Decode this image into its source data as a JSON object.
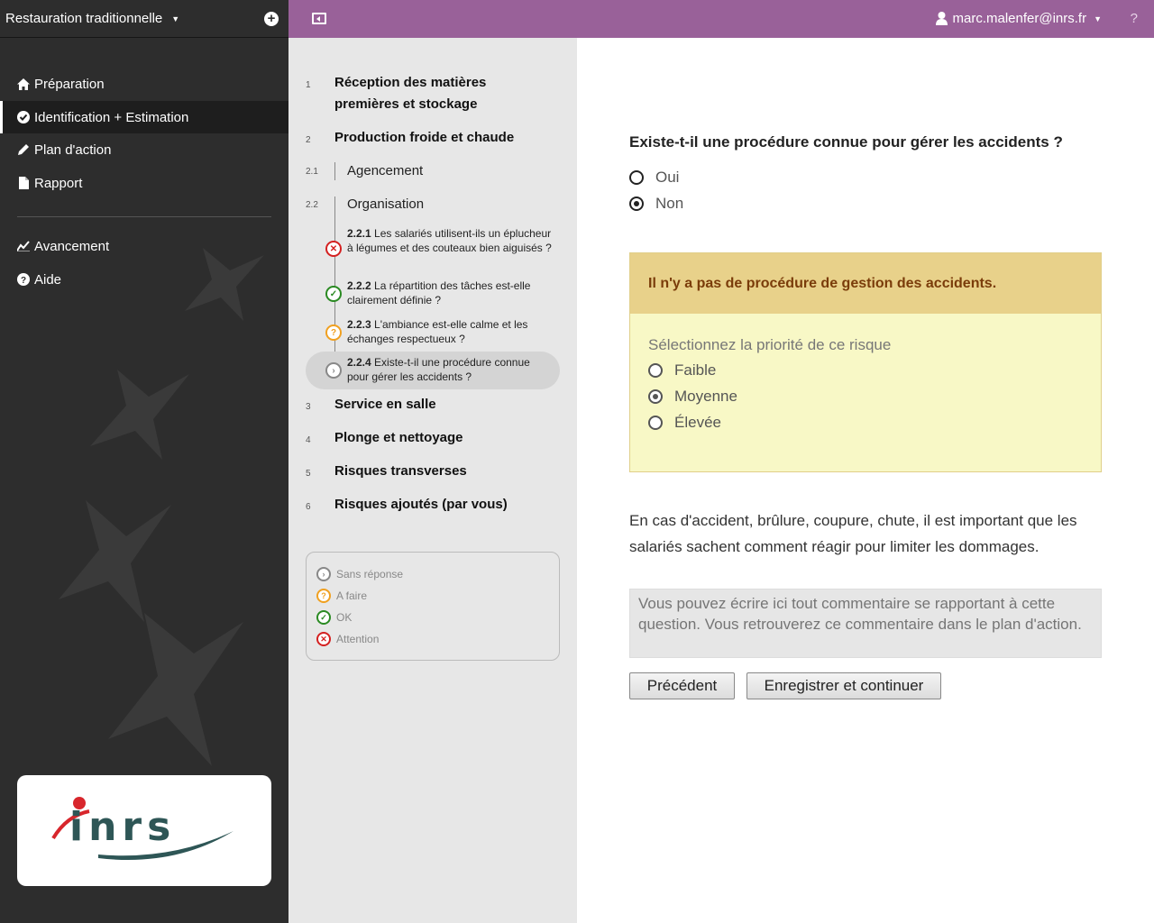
{
  "sidebar": {
    "survey_title": "Restauration traditionnelle",
    "nav": [
      {
        "label": "Préparation",
        "icon": "home-icon",
        "active": false
      },
      {
        "label": "Identification + Estimation",
        "icon": "check-circle-icon",
        "active": true
      },
      {
        "label": "Plan d'action",
        "icon": "pencil-icon",
        "active": false
      },
      {
        "label": "Rapport",
        "icon": "document-icon",
        "active": false
      },
      {
        "label": "Avancement",
        "icon": "chart-line-icon",
        "active": false
      },
      {
        "label": "Aide",
        "icon": "question-circle-icon",
        "active": false
      }
    ],
    "logo_text": "inrs"
  },
  "topbar": {
    "user": "marc.malenfer@inrs.fr",
    "help": "?"
  },
  "tree": {
    "modules": [
      {
        "num": "1",
        "title": "Réception des matières premières et stockage"
      },
      {
        "num": "2",
        "title": "Production froide et chaude"
      },
      {
        "num": "3",
        "title": "Service en salle"
      },
      {
        "num": "4",
        "title": "Plonge et nettoyage"
      },
      {
        "num": "5",
        "title": "Risques transverses"
      },
      {
        "num": "6",
        "title": "Risques ajoutés (par vous)"
      }
    ],
    "submodules": [
      {
        "num": "2.1",
        "title": "Agencement"
      },
      {
        "num": "2.2",
        "title": "Organisation"
      }
    ],
    "questions": [
      {
        "num": "2.2.1",
        "text": "Les salariés utilisent-ils un éplucheur à légumes et des couteaux bien aiguisés ?",
        "status": "attention"
      },
      {
        "num": "2.2.2",
        "text": "La répartition des tâches est-elle clairement définie ?",
        "status": "ok"
      },
      {
        "num": "2.2.3",
        "text": "L'ambiance est-elle calme et les échanges respectueux ?",
        "status": "todo"
      },
      {
        "num": "2.2.4",
        "text": "Existe-t-il une procédure connue pour gérer les accidents ?",
        "status": "unanswered"
      }
    ],
    "legend": [
      {
        "label": "Sans réponse",
        "status": "unanswered"
      },
      {
        "label": "A faire",
        "status": "todo"
      },
      {
        "label": "OK",
        "status": "ok"
      },
      {
        "label": "Attention",
        "status": "attention"
      }
    ]
  },
  "question": {
    "title": "Existe-t-il une procédure connue pour gérer les accidents ?",
    "answers": [
      {
        "label": "Oui",
        "checked": false
      },
      {
        "label": "Non",
        "checked": true
      }
    ],
    "risk_title": "Il n'y a pas de procédure de gestion des accidents.",
    "priority_label": "Sélectionnez la priorité de ce risque",
    "priorities": [
      {
        "label": "Faible",
        "checked": false
      },
      {
        "label": "Moyenne",
        "checked": true
      },
      {
        "label": "Élevée",
        "checked": false
      }
    ],
    "info": "En cas d'accident, brûlure, coupure, chute, il est important que les salariés sachent comment réagir pour limiter les dommages.",
    "comment_placeholder": "Vous pouvez écrire ici tout commentaire se rapportant à cette question. Vous retrouverez ce commentaire dans le plan d'action.",
    "prev_label": "Précédent",
    "next_label": "Enregistrer et continuer"
  },
  "colors": {
    "topbar": "#996199",
    "sidebar": "#2d2d2d",
    "risk_header": "#e8d18a",
    "risk_body": "#f8f8c6",
    "status_ok": "#2a8a22",
    "status_attention": "#d42020",
    "status_todo": "#f0a020",
    "status_unanswered": "#888888"
  }
}
